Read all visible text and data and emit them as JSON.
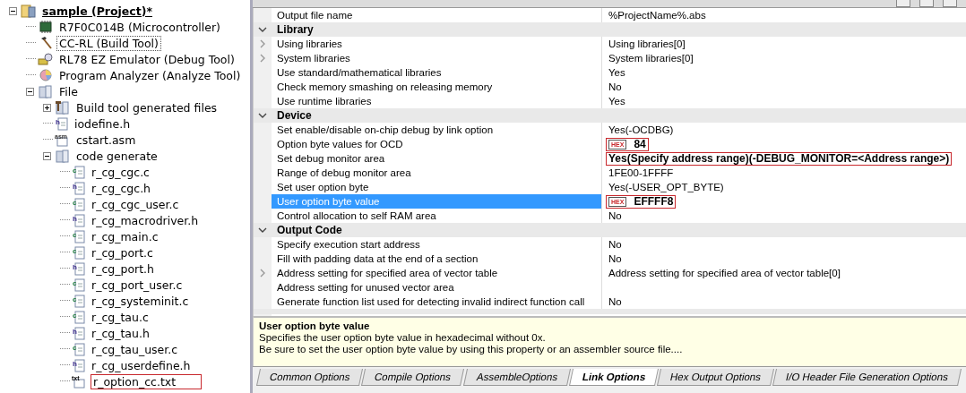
{
  "project_tree": [
    {
      "label": "sample (Project)*",
      "kind": "project",
      "expanded": true,
      "bold": true,
      "children": [
        {
          "label": "R7F0C014B (Microcontroller)",
          "kind": "chip"
        },
        {
          "label": "CC-RL (Build Tool)",
          "kind": "build-tool",
          "focused": true
        },
        {
          "label": "RL78 EZ Emulator (Debug Tool)",
          "kind": "debug-tool"
        },
        {
          "label": "Program Analyzer (Analyze Tool)",
          "kind": "analyzer"
        },
        {
          "label": "File",
          "kind": "folder",
          "expanded": true,
          "children": [
            {
              "label": "Build tool generated files",
              "kind": "build-folder",
              "expanded": false
            },
            {
              "label": "iodefine.h",
              "kind": "h"
            },
            {
              "label": "cstart.asm",
              "kind": "asm"
            },
            {
              "label": "code generate",
              "kind": "folder",
              "expanded": true,
              "children": [
                {
                  "label": "r_cg_cgc.c",
                  "kind": "c"
                },
                {
                  "label": "r_cg_cgc.h",
                  "kind": "h"
                },
                {
                  "label": "r_cg_cgc_user.c",
                  "kind": "c"
                },
                {
                  "label": "r_cg_macrodriver.h",
                  "kind": "h"
                },
                {
                  "label": "r_cg_main.c",
                  "kind": "c"
                },
                {
                  "label": "r_cg_port.c",
                  "kind": "c"
                },
                {
                  "label": "r_cg_port.h",
                  "kind": "h"
                },
                {
                  "label": "r_cg_port_user.c",
                  "kind": "c"
                },
                {
                  "label": "r_cg_systeminit.c",
                  "kind": "c"
                },
                {
                  "label": "r_cg_tau.c",
                  "kind": "c"
                },
                {
                  "label": "r_cg_tau.h",
                  "kind": "h"
                },
                {
                  "label": "r_cg_tau_user.c",
                  "kind": "c"
                },
                {
                  "label": "r_cg_userdefine.h",
                  "kind": "h"
                },
                {
                  "label": "r_option_cc.txt",
                  "kind": "txt",
                  "highlighted": true
                }
              ]
            }
          ]
        }
      ]
    }
  ],
  "properties": [
    {
      "kind": "property",
      "name": "Output file name",
      "value": "%ProjectName%.abs"
    },
    {
      "kind": "category",
      "name": "Library",
      "expanded": true
    },
    {
      "kind": "property",
      "name": "Using libraries",
      "value": "Using libraries[0]",
      "expandable": true
    },
    {
      "kind": "property",
      "name": "System libraries",
      "value": "System libraries[0]",
      "expandable": true
    },
    {
      "kind": "property",
      "name": "Use standard/mathematical libraries",
      "value": "Yes"
    },
    {
      "kind": "property",
      "name": "Check memory smashing on releasing memory",
      "value": "No"
    },
    {
      "kind": "property",
      "name": "Use runtime libraries",
      "value": "Yes"
    },
    {
      "kind": "category",
      "name": "Device",
      "expanded": true
    },
    {
      "kind": "property",
      "name": "Set enable/disable on-chip debug by link option",
      "value": "Yes(-OCDBG)"
    },
    {
      "kind": "property",
      "name": "Option byte values for OCD",
      "value": "84",
      "badge": "HEX",
      "modified": true,
      "highlighted": true
    },
    {
      "kind": "property",
      "name": "Set debug monitor area",
      "value": "Yes(Specify address range)(-DEBUG_MONITOR=<Address range>)",
      "modified": true,
      "highlighted": true
    },
    {
      "kind": "property",
      "name": "Range of debug monitor area",
      "value": "1FE00-1FFFF"
    },
    {
      "kind": "property",
      "name": "Set user option byte",
      "value": "Yes(-USER_OPT_BYTE)"
    },
    {
      "kind": "property",
      "name": "User option byte value",
      "value": "EFFFF8",
      "badge": "HEX",
      "modified": true,
      "highlighted": true,
      "selected": true
    },
    {
      "kind": "property",
      "name": "Control allocation to self RAM area",
      "value": "No"
    },
    {
      "kind": "category",
      "name": "Output Code",
      "expanded": true
    },
    {
      "kind": "property",
      "name": "Specify execution start address",
      "value": "No"
    },
    {
      "kind": "property",
      "name": "Fill with padding data at the end of a section",
      "value": "No"
    },
    {
      "kind": "property",
      "name": "Address setting for specified area of vector table",
      "value": "Address setting for specified area of vector table[0]",
      "expandable": true
    },
    {
      "kind": "property",
      "name": "Address setting for unused vector area"
    },
    {
      "kind": "property",
      "name": "Generate function list used for detecting invalid indirect function call",
      "value": "No"
    }
  ],
  "description": {
    "title": "User option byte value",
    "lines": [
      "Specifies the user option byte value in hexadecimal without 0x.",
      "Be sure to set the user option byte value by using this property or an assembler source file...."
    ]
  },
  "tabs": [
    {
      "label": "Common Options",
      "selected": false
    },
    {
      "label": "Compile Options",
      "selected": false
    },
    {
      "label": "AssembleOptions",
      "selected": false
    },
    {
      "label": "Link Options",
      "selected": true
    },
    {
      "label": "Hex Output Options",
      "selected": false
    },
    {
      "label": "I/O Header File Generation Options",
      "selected": false
    }
  ]
}
